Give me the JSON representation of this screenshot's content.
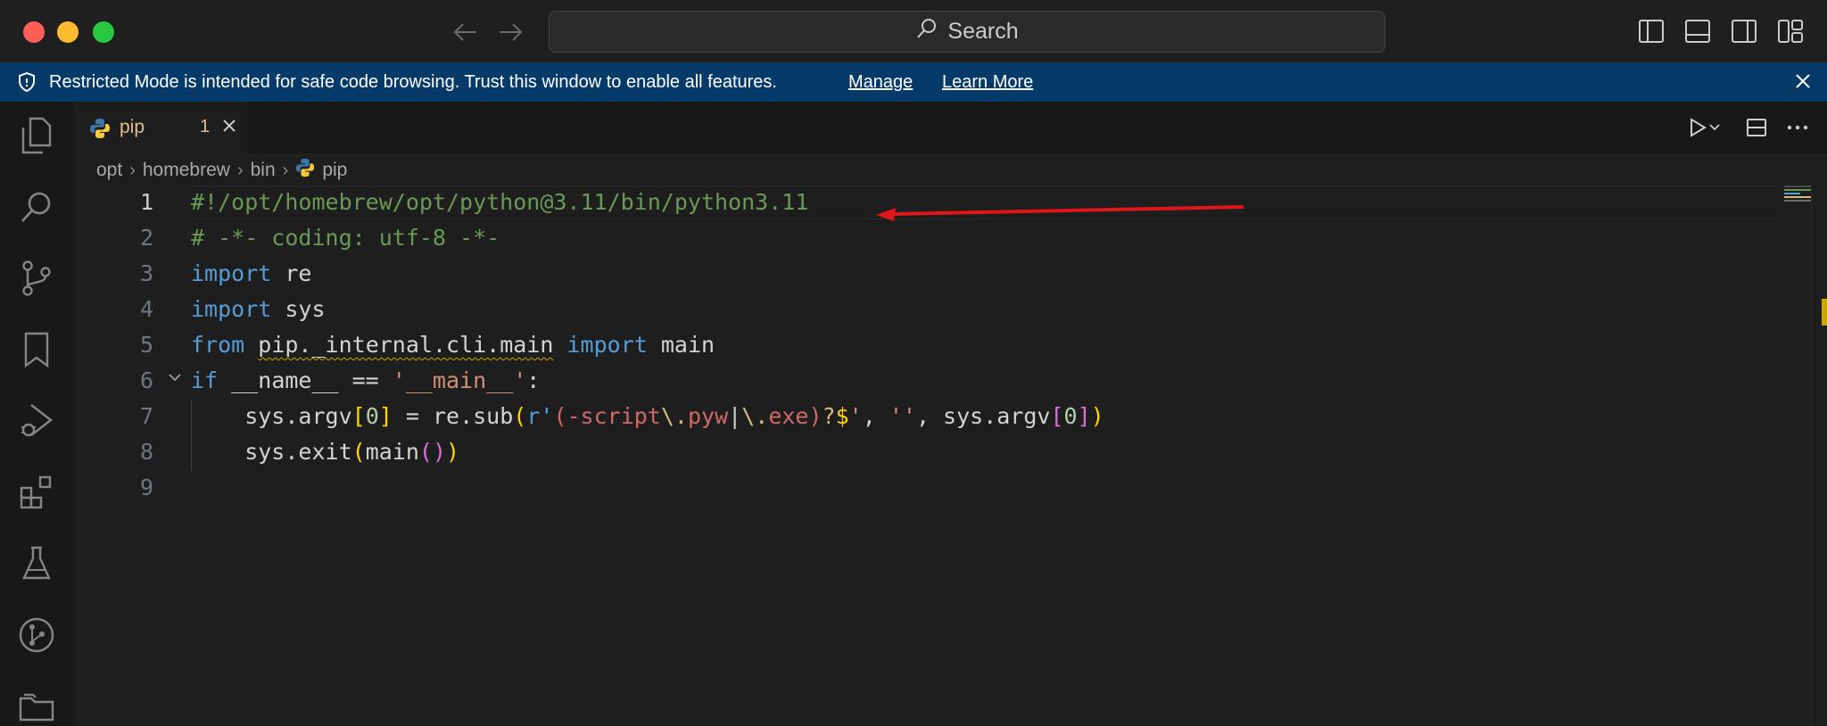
{
  "titlebar": {
    "search_placeholder": "Search"
  },
  "banner": {
    "message": "Restricted Mode is intended for safe code browsing. Trust this window to enable all features.",
    "manage_label": "Manage",
    "learn_more_label": "Learn More"
  },
  "tab": {
    "name": "pip",
    "problems_count": "1"
  },
  "breadcrumb": [
    "opt",
    "homebrew",
    "bin",
    "pip"
  ],
  "gutter": [
    "1",
    "2",
    "3",
    "4",
    "5",
    "6",
    "7",
    "8",
    "9"
  ],
  "code": {
    "l1": "#!/opt/homebrew/opt/python@3.11/bin/python3.11",
    "l2": "# -*- coding: utf-8 -*-",
    "l3_kw": "import",
    "l3_id": " re",
    "l4_kw": "import",
    "l4_id": " sys",
    "l5_kw1": "from",
    "l5_mod": "pip._internal.cli.main",
    "l5_kw2": "import",
    "l5_id": " main",
    "l6_kw": "if",
    "l6_mid": " __name__ == ",
    "l6_str": "'__main__'",
    "l6_end": ":",
    "l7_a": "    sys.argv",
    "l7_b1": "[",
    "l7_n1": "0",
    "l7_b2": "]",
    "l7_c": " = re.sub",
    "l7_p1": "(",
    "l7_r": "r'",
    "l7_re1": "(-script",
    "l7_esc1": "\\.",
    "l7_re2": "pyw",
    "l7_pipe": "|",
    "l7_esc2": "\\.",
    "l7_re3": "exe)",
    "l7_q": "?",
    "l7_dollar": "$",
    "l7_rq": "'",
    "l7_comma": ", ",
    "l7_empty": "''",
    "l7_d": ", sys.argv",
    "l7_b3": "[",
    "l7_n2": "0",
    "l7_b4": "]",
    "l7_p2": ")",
    "l8_a": "    sys.exit",
    "l8_p1": "(",
    "l8_b": "main",
    "l8_p2": "()",
    "l8_p3": ")"
  },
  "colors": {
    "banner": "#063b69",
    "editor_bg": "#1e1e1e",
    "annotation_arrow": "#e0161b"
  }
}
